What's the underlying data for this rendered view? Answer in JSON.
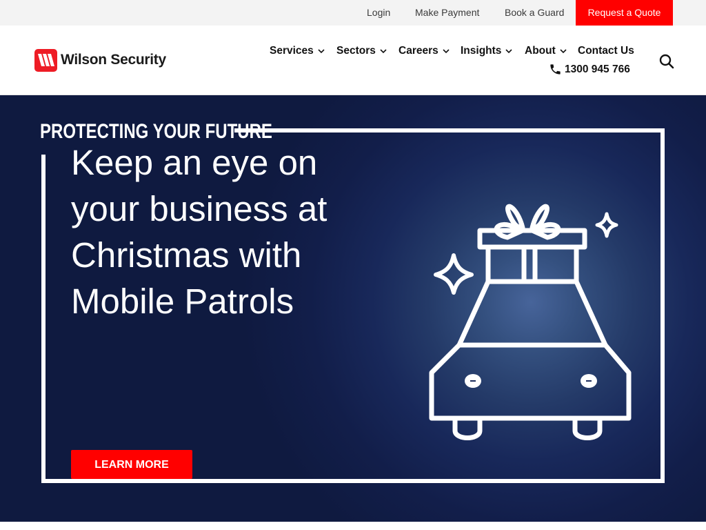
{
  "utility_bar": {
    "login": "Login",
    "make_payment": "Make Payment",
    "book_guard": "Book a Guard",
    "request_quote": "Request a Quote"
  },
  "header": {
    "logo_text": "Wilson Security",
    "nav": {
      "services": "Services",
      "sectors": "Sectors",
      "careers": "Careers",
      "insights": "Insights",
      "about": "About",
      "contact": "Contact Us"
    },
    "phone": "1300 945 766",
    "icons": {
      "chevron": "chevron-down-icon",
      "phone": "phone-icon",
      "search": "search-icon"
    }
  },
  "hero": {
    "kicker": "PROTECTING YOUR FUTURE",
    "headline": "Keep an eye on your business at Christmas with Mobile Patrols",
    "cta": "LEARN MORE",
    "illustration": "car-with-gift-icon"
  },
  "colors": {
    "brand_red": "#ff0000",
    "hero_navy": "#0f1a40",
    "text_dark": "#111111"
  }
}
